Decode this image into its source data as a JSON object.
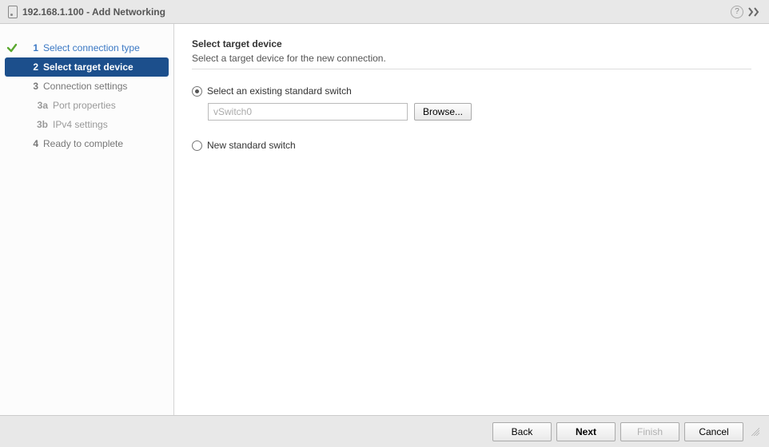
{
  "header": {
    "title": "192.168.1.100 - Add Networking"
  },
  "sidebar": {
    "step1": {
      "num": "1",
      "label": "Select connection type"
    },
    "step2": {
      "num": "2",
      "label": "Select target device"
    },
    "step3": {
      "num": "3",
      "label": "Connection settings"
    },
    "step3a": {
      "num": "3a",
      "label": "Port properties"
    },
    "step3b": {
      "num": "3b",
      "label": "IPv4 settings"
    },
    "step4": {
      "num": "4",
      "label": "Ready to complete"
    }
  },
  "content": {
    "title": "Select target device",
    "subtitle": "Select a target device for the new connection.",
    "opt_existing": "Select an existing standard switch",
    "switch_value": "vSwitch0",
    "browse": "Browse...",
    "opt_new": "New standard switch"
  },
  "footer": {
    "back": "Back",
    "next": "Next",
    "finish": "Finish",
    "cancel": "Cancel"
  }
}
